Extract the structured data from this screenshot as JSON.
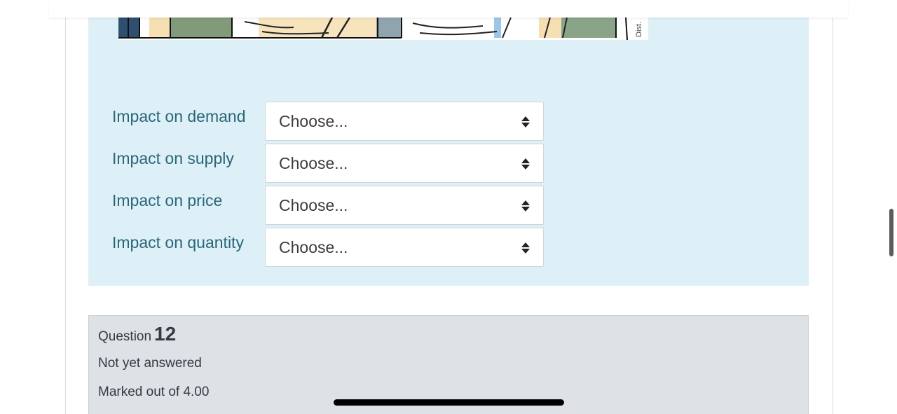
{
  "cartoon": {
    "credit_text": "Dist."
  },
  "questions": {
    "rows": [
      {
        "label": "Impact on demand",
        "selected": "Choose..."
      },
      {
        "label": "Impact on supply",
        "selected": "Choose..."
      },
      {
        "label": "Impact on price",
        "selected": "Choose..."
      },
      {
        "label": "Impact on quantity",
        "selected": "Choose..."
      }
    ]
  },
  "next_question": {
    "word": "Question",
    "number": "12",
    "status": "Not yet answered",
    "marks": "Marked out of 4.00"
  },
  "colors": {
    "panel_bg": "#def0f7",
    "label_text": "#2a6678",
    "info_card_bg": "#dee2e6"
  },
  "icons": {
    "select_arrows": "up-down-caret-icon"
  }
}
